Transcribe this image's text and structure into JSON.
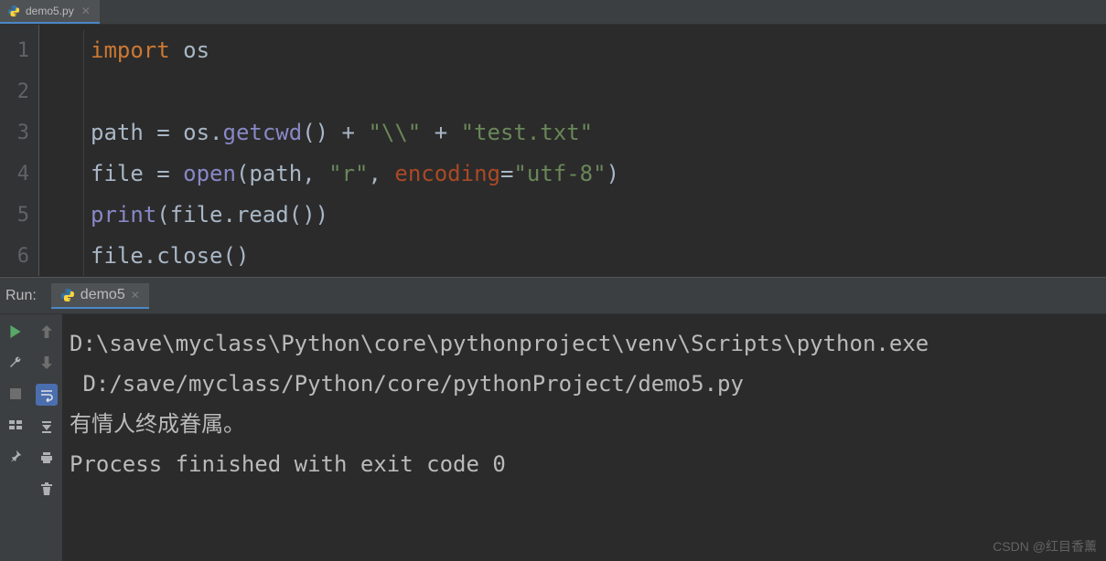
{
  "tab": {
    "filename": "demo5.py"
  },
  "editor": {
    "lines": [
      "1",
      "2",
      "3",
      "4",
      "5",
      "6"
    ],
    "code": {
      "l1_import": "import",
      "l1_os": " os",
      "l3_a": "path = os.",
      "l3_b": "getcwd",
      "l3_c": "() + ",
      "l3_d": "\"\\\\\"",
      "l3_e": " + ",
      "l3_f": "\"test.txt\"",
      "l4_a": "file = ",
      "l4_b": "open",
      "l4_c": "(path, ",
      "l4_d": "\"r\"",
      "l4_e": ", ",
      "l4_f": "encoding",
      "l4_g": "=",
      "l4_h": "\"utf-8\"",
      "l4_i": ")",
      "l5_a": "print",
      "l5_b": "(file.read())",
      "l6_a": "file.close()"
    }
  },
  "run": {
    "label": "Run:",
    "tabname": "demo5",
    "out1": "D:\\save\\myclass\\Python\\core\\pythonproject\\venv\\Scripts\\python.exe",
    "out2": " D:/save/myclass/Python/core/pythonProject/demo5.py",
    "out3": "有情人终成眷属。",
    "out4": "",
    "out5": "Process finished with exit code 0"
  },
  "watermark": "CSDN @红目香薰"
}
